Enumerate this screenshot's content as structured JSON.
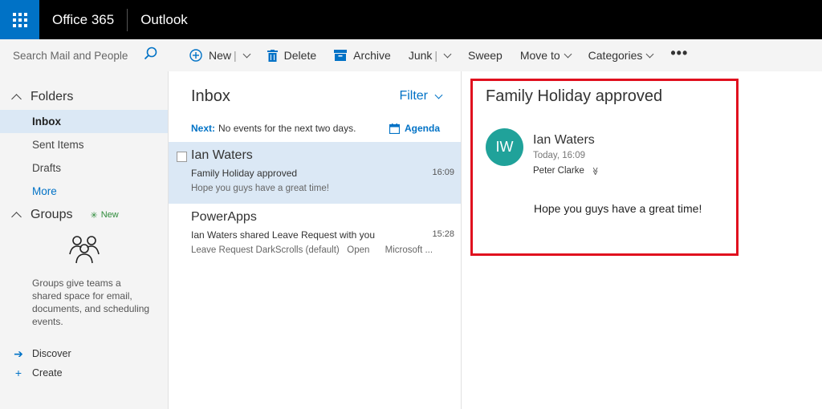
{
  "topbar": {
    "suite_name": "Office 365",
    "app_name": "Outlook"
  },
  "search": {
    "placeholder": "Search Mail and People"
  },
  "commands": {
    "new_label": "New",
    "delete_label": "Delete",
    "archive_label": "Archive",
    "junk_label": "Junk",
    "sweep_label": "Sweep",
    "moveto_label": "Move to",
    "categories_label": "Categories",
    "more_label": "•••"
  },
  "nav": {
    "folders_label": "Folders",
    "items": [
      {
        "label": "Inbox"
      },
      {
        "label": "Sent Items"
      },
      {
        "label": "Drafts"
      },
      {
        "label": "More"
      }
    ],
    "groups_label": "Groups",
    "new_badge": "New",
    "groups_description": "Groups give teams a shared space for email, documents, and scheduling events.",
    "discover_label": "Discover",
    "create_label": "Create"
  },
  "list": {
    "title": "Inbox",
    "filter_label": "Filter",
    "next_label": "Next:",
    "next_text": "No events for the next two days.",
    "agenda_label": "Agenda",
    "messages": [
      {
        "sender": "Ian Waters",
        "subject": "Family Holiday approved",
        "time": "16:09",
        "preview": "Hope you guys have a great time!"
      },
      {
        "sender": "PowerApps",
        "subject": "Ian Waters shared Leave Request with you",
        "time": "15:28",
        "preview": "Leave Request DarkScrolls (default)   Open      Microsoft ..."
      }
    ]
  },
  "reading": {
    "subject": "Family Holiday approved",
    "avatar_initials": "IW",
    "sender": "Ian Waters",
    "time": "Today, 16:09",
    "to": "Peter Clarke",
    "to_chevron": "≫",
    "body": "Hope you guys have a great time!"
  },
  "colors": {
    "accent": "#0072c6",
    "avatar": "#20a29a",
    "highlight": "#e0101e",
    "selected_bg": "#dbe8f5"
  }
}
